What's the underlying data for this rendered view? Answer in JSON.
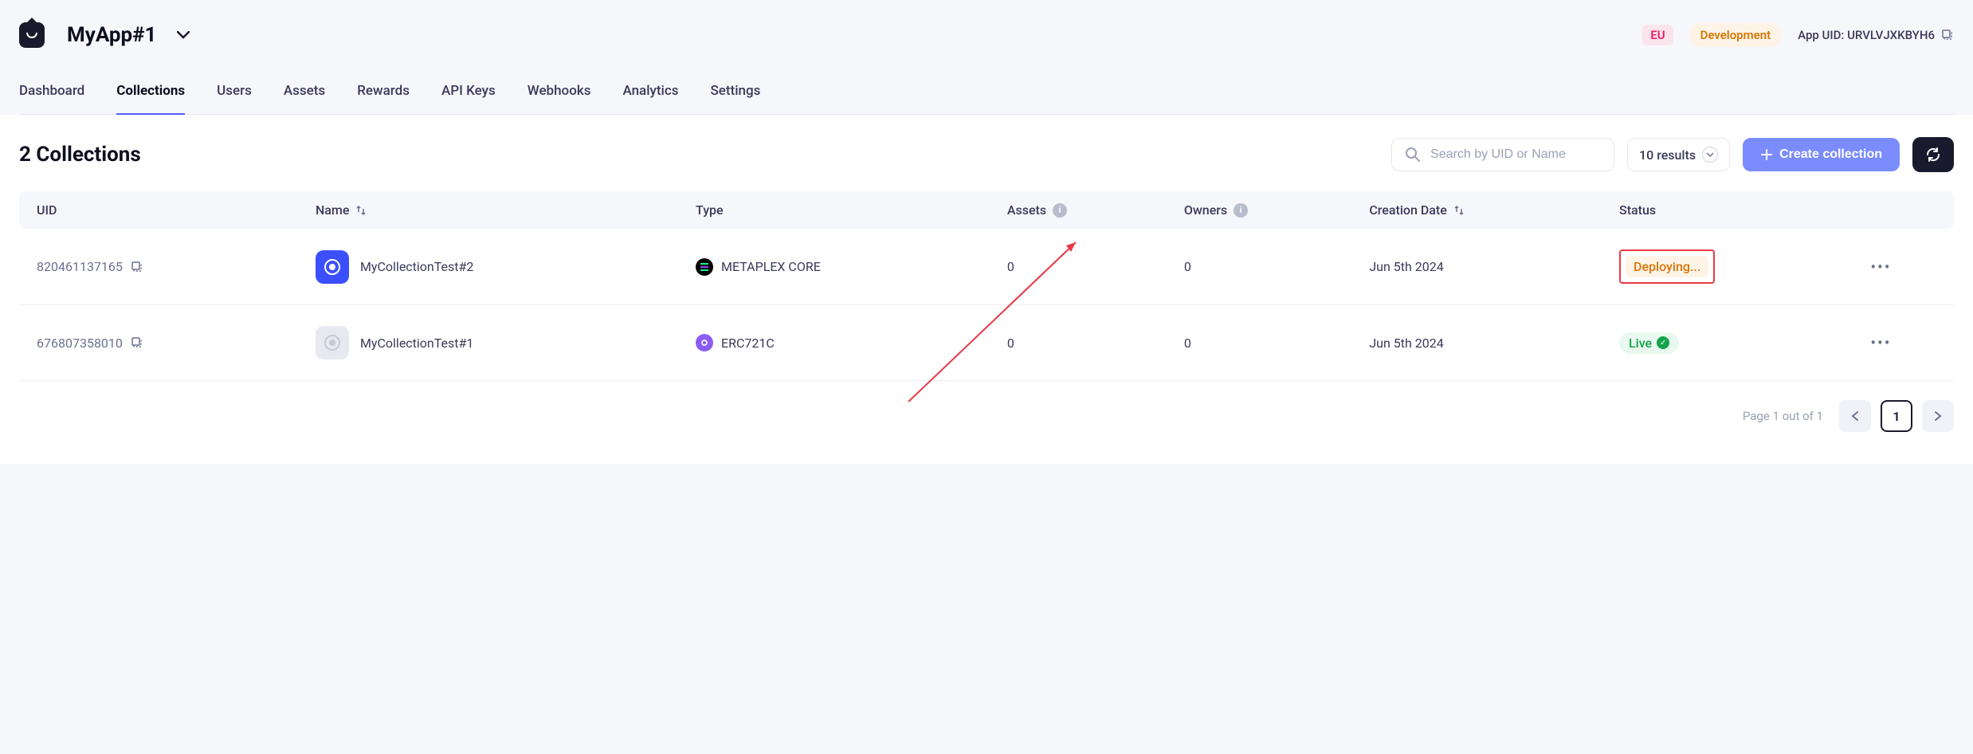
{
  "header": {
    "app_name": "MyApp#1",
    "region_badge": "EU",
    "env_badge": "Development",
    "app_uid_label": "App UID: URVLVJXKBYH6"
  },
  "tabs": [
    {
      "label": "Dashboard",
      "active": false
    },
    {
      "label": "Collections",
      "active": true
    },
    {
      "label": "Users",
      "active": false
    },
    {
      "label": "Assets",
      "active": false
    },
    {
      "label": "Rewards",
      "active": false
    },
    {
      "label": "API Keys",
      "active": false
    },
    {
      "label": "Webhooks",
      "active": false
    },
    {
      "label": "Analytics",
      "active": false
    },
    {
      "label": "Settings",
      "active": false
    }
  ],
  "page": {
    "title": "2 Collections",
    "search_placeholder": "Search by UID or Name",
    "results_select": "10 results",
    "create_button": "Create collection"
  },
  "table": {
    "columns": {
      "uid": "UID",
      "name": "Name",
      "type": "Type",
      "assets": "Assets",
      "owners": "Owners",
      "creation_date": "Creation Date",
      "status": "Status"
    },
    "rows": [
      {
        "uid": "820461137165",
        "name": "MyCollectionTest#2",
        "type": "METAPLEX CORE",
        "assets": "0",
        "owners": "0",
        "creation_date": "Jun 5th 2024",
        "status": "Deploying..."
      },
      {
        "uid": "676807358010",
        "name": "MyCollectionTest#1",
        "type": "ERC721C",
        "assets": "0",
        "owners": "0",
        "creation_date": "Jun 5th 2024",
        "status": "Live"
      }
    ]
  },
  "pagination": {
    "info": "Page 1 out of 1",
    "current": "1"
  }
}
